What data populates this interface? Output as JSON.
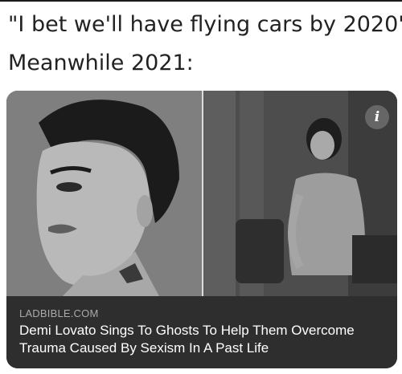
{
  "caption": {
    "line1": "\"I bet we'll have flying cars by 2020\"",
    "line2": "Meanwhile 2021:"
  },
  "card": {
    "info_icon_label": "i",
    "source": "LADBIBLE.COM",
    "headline": "Demi Lovato Sings To Ghosts To Help Them Overcome Trauma Caused By Sexism In A Past Life"
  },
  "colors": {
    "card_background": "#2e2e2e",
    "source_text": "#a9a9a9",
    "headline_text": "#ffffff"
  }
}
